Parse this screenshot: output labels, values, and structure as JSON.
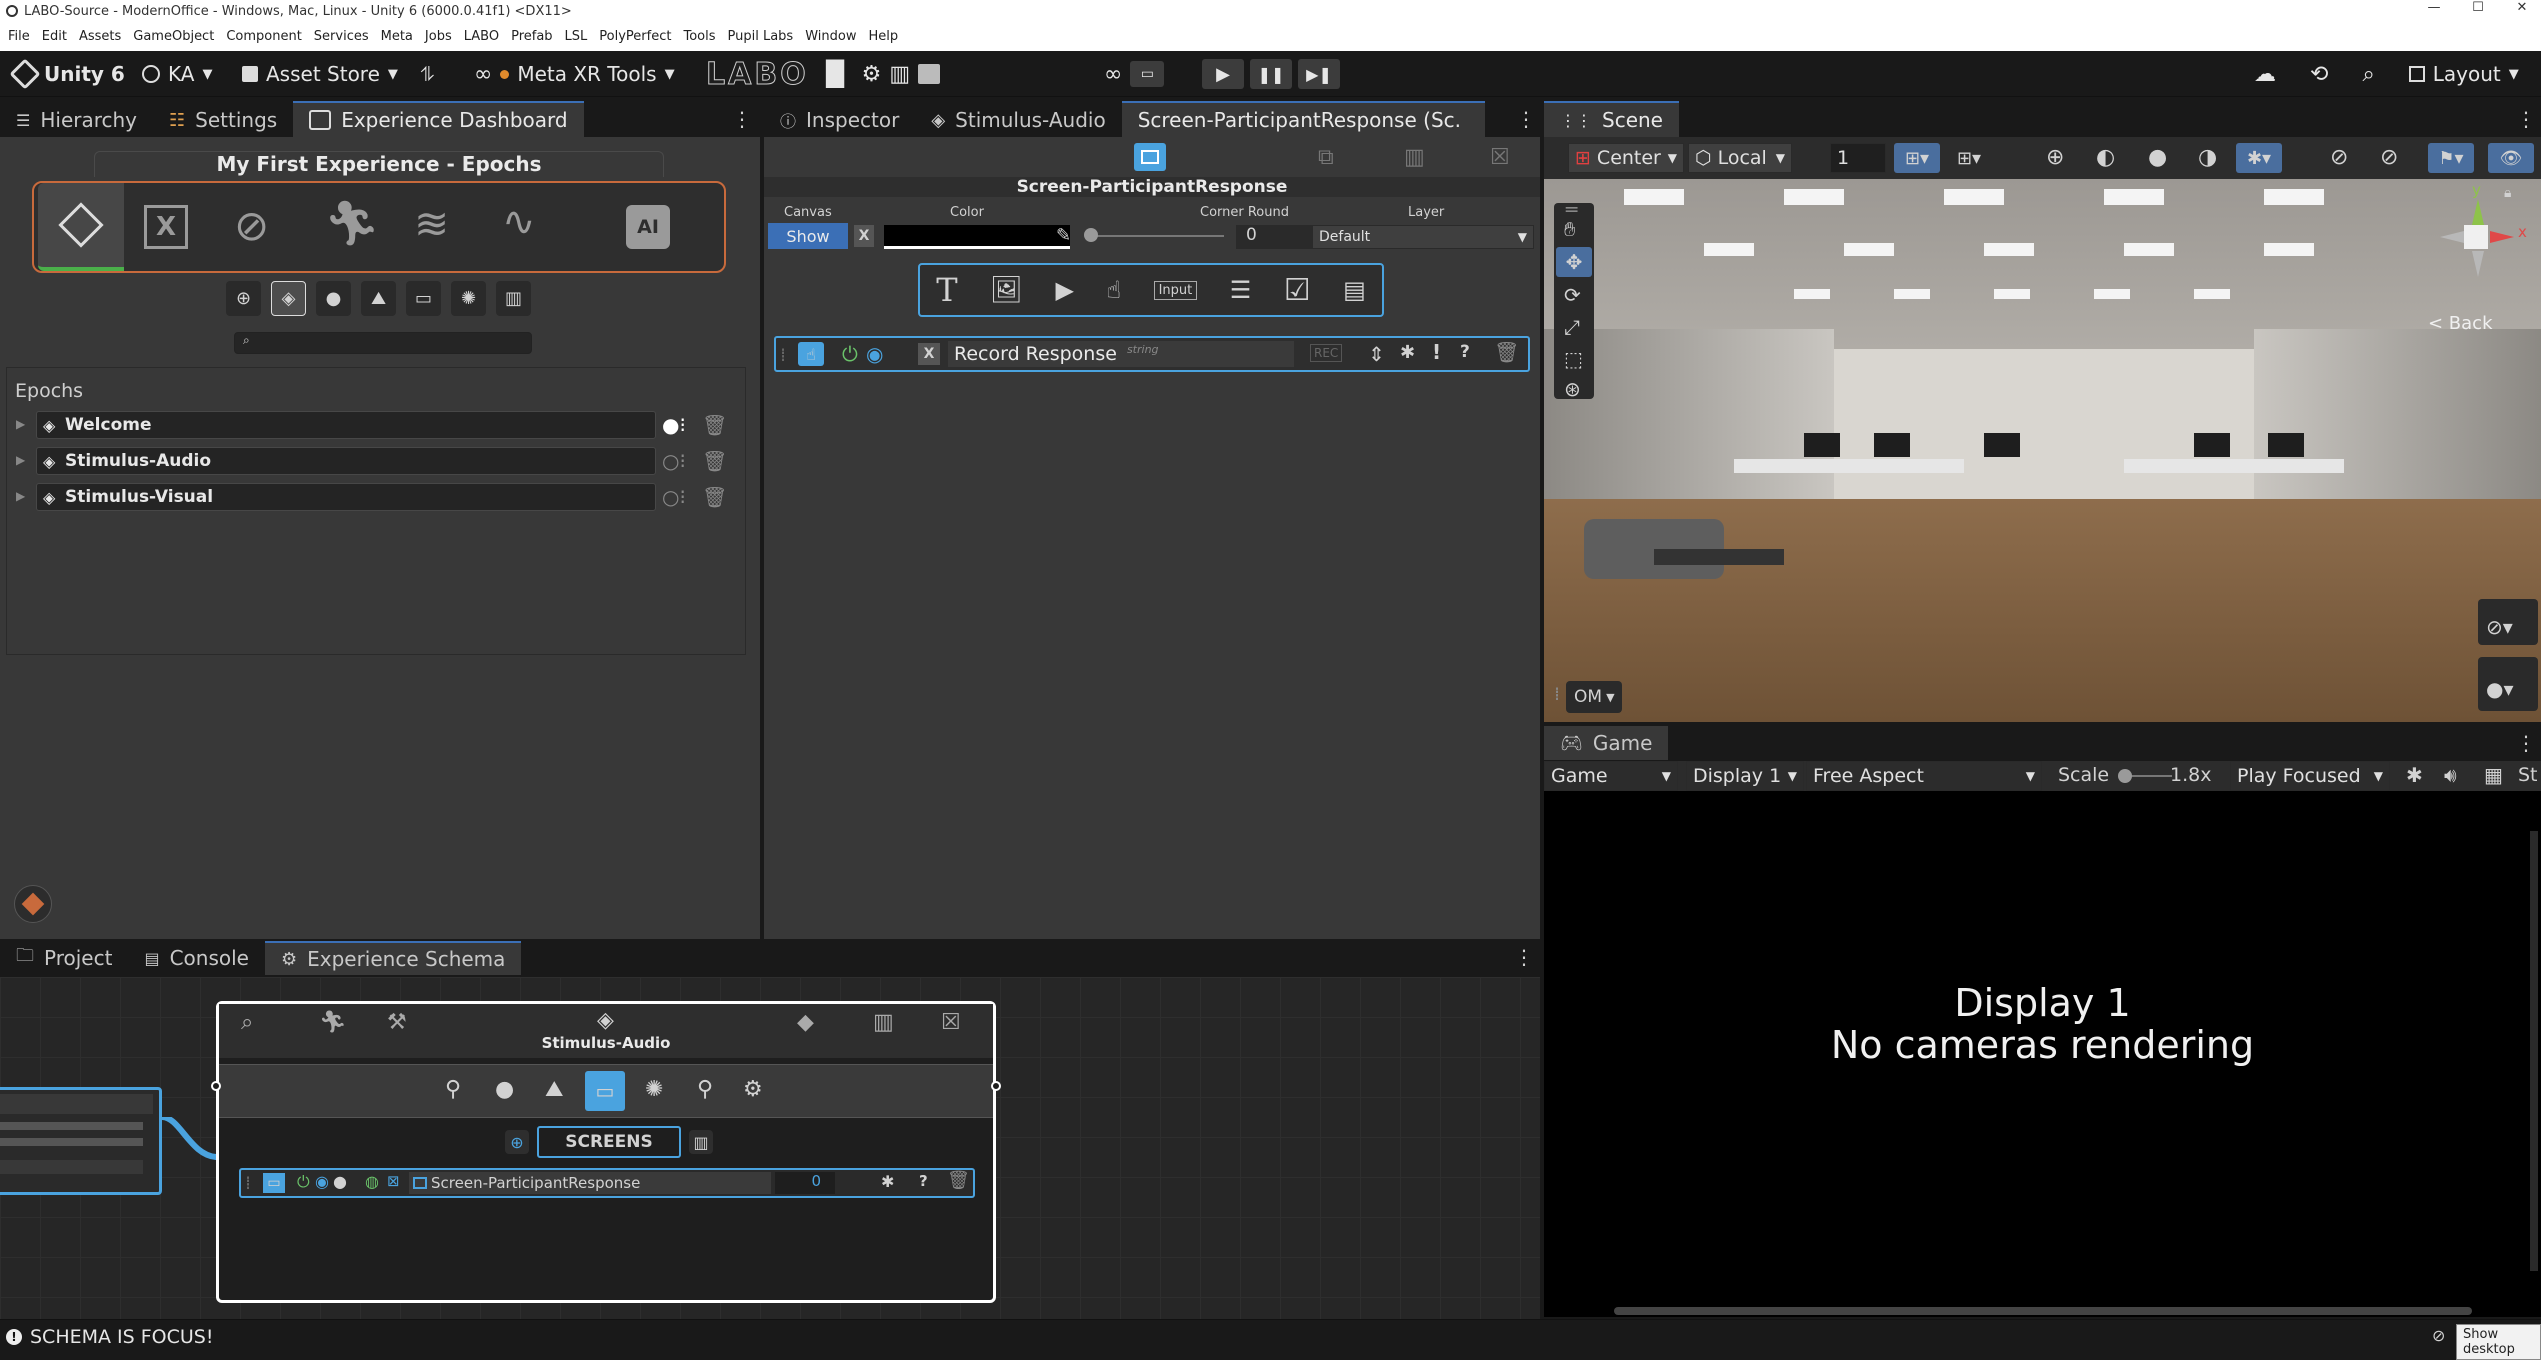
{
  "window": {
    "title": "LABO-Source - ModernOffice - Windows, Mac, Linux - Unity 6 (6000.0.41f1) <DX11>"
  },
  "menu": [
    "File",
    "Edit",
    "Assets",
    "GameObject",
    "Component",
    "Services",
    "Meta",
    "Jobs",
    "LABO",
    "Prefab",
    "LSL",
    "PolyPerfect",
    "Tools",
    "Pupil Labs",
    "Window",
    "Help"
  ],
  "toolbar": {
    "unity_label": "Unity 6",
    "account": "KA",
    "asset_store": "Asset Store",
    "meta_xr": "Meta XR Tools",
    "labo_logo": "LABO",
    "layout": "Layout"
  },
  "left_tabs": {
    "hierarchy": "Hierarchy",
    "settings": "Settings",
    "dashboard": "Experience Dashboard"
  },
  "dashboard": {
    "title": "My First Experience - Epochs",
    "section": "Epochs",
    "epochs": [
      {
        "name": "Welcome"
      },
      {
        "name": "Stimulus-Audio"
      },
      {
        "name": "Stimulus-Visual"
      }
    ]
  },
  "inspector_tabs": {
    "inspector": "Inspector",
    "stimulus": "Stimulus-Audio",
    "screen": "Screen-ParticipantResponse (Sc."
  },
  "inspector": {
    "title": "Screen-ParticipantResponse",
    "col_canvas": "Canvas",
    "col_color": "Color",
    "col_corner": "Corner Round",
    "col_layer": "Layer",
    "show_btn": "Show",
    "x_btn": "X",
    "corner_value": "0",
    "layer_value": "Default",
    "element_label": "Record Response",
    "element_type": "string",
    "element_x": "X",
    "element_q": "?",
    "element_excl": "!"
  },
  "scene": {
    "tab": "Scene",
    "pivot": "Center",
    "space": "Local",
    "grid_value": "1",
    "gizmo_y": "y",
    "gizmo_x": "x",
    "back": "< Back",
    "om": "OM"
  },
  "game": {
    "tab": "Game",
    "mode": "Game",
    "display": "Display 1",
    "aspect": "Free Aspect",
    "scale_label": "Scale",
    "scale_value": "1.8x",
    "play_mode": "Play Focused",
    "stats": "St",
    "message_line1": "Display 1",
    "message_line2": "No cameras rendering"
  },
  "bottom_tabs": {
    "project": "Project",
    "console": "Console",
    "schema": "Experience Schema"
  },
  "schema": {
    "node_title": "Stimulus-Audio",
    "screens_label": "SCREENS",
    "screen_row_label": "Screen-ParticipantResponse",
    "screen_row_value": "0",
    "screen_row_q": "?"
  },
  "statusbar": {
    "message": "SCHEMA IS FOCUS!",
    "show_desktop": "Show desktop"
  },
  "colors": {
    "accent": "#3b6fb6",
    "dashboard_border_warm": "#c86a3c",
    "selection_blue": "#4aa3df",
    "node_border": "#ffffff",
    "schema_link": "#4aa3df"
  }
}
